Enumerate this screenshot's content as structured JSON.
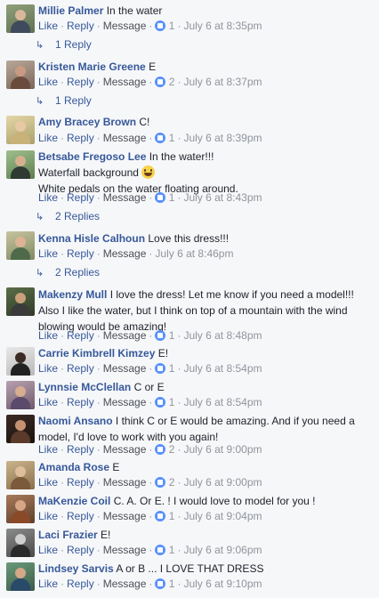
{
  "actions": {
    "like": "Like",
    "reply": "Reply",
    "message": "Message",
    "sep": "·"
  },
  "colors": {
    "link": "#365899",
    "meta": "#90949c",
    "background": "#f6f7f9",
    "like_badge": "#5890ff"
  },
  "comments": [
    {
      "name": "Millie Palmer",
      "text": "In the water",
      "likes": "1",
      "time": "July 6 at 8:35pm",
      "replies": "1 Reply"
    },
    {
      "name": "Kristen Marie Greene",
      "text": "E",
      "likes": "2",
      "time": "July 6 at 8:37pm",
      "replies": "1 Reply"
    },
    {
      "name": "Amy Bracey Brown",
      "text": "C!",
      "likes": "1",
      "time": "July 6 at 8:39pm"
    },
    {
      "name": "Betsabe Fregoso Lee",
      "text": "In the water!!!",
      "line2": "Waterfall background",
      "line3": "White pedals on the water floating around.",
      "likes": "1",
      "time": "July 6 at 8:43pm",
      "replies": "2 Replies",
      "emoji": "grinning-face"
    },
    {
      "name": "Kenna Hisle Calhoun",
      "text": "Love this dress!!!",
      "time": "July 6 at 8:46pm",
      "replies": "2 Replies"
    },
    {
      "name": "Makenzy Mull",
      "text": "I love the dress! Let me know if you need a model!!! Also I like the water, but I think on top of a mountain with the wind blowing would be amazing!",
      "likes": "1",
      "time": "July 6 at 8:48pm"
    },
    {
      "name": "Carrie Kimbrell Kimzey",
      "text": "E!",
      "likes": "1",
      "time": "July 6 at 8:54pm"
    },
    {
      "name": "Lynnsie McClellan",
      "text": "C or E",
      "likes": "1",
      "time": "July 6 at 8:54pm"
    },
    {
      "name": "Naomi Ansano",
      "text": "I think C or E would be amazing. And if you need a model, I'd love to work with you again!",
      "likes": "2",
      "time": "July 6 at 9:00pm"
    },
    {
      "name": "Amanda Rose",
      "text": "E",
      "likes": "2",
      "time": "July 6 at 9:00pm"
    },
    {
      "name": "MaKenzie Coil",
      "text": "C. A. Or E. ! I would love to model for you !",
      "likes": "1",
      "time": "July 6 at 9:04pm"
    },
    {
      "name": "Laci Frazier",
      "text": "E!",
      "likes": "1",
      "time": "July 6 at 9:06pm"
    },
    {
      "name": "Lindsey Sarvis",
      "text": "A or B ... I LOVE THAT DRESS",
      "likes": "1",
      "time": "July 6 at 9:10pm"
    }
  ]
}
